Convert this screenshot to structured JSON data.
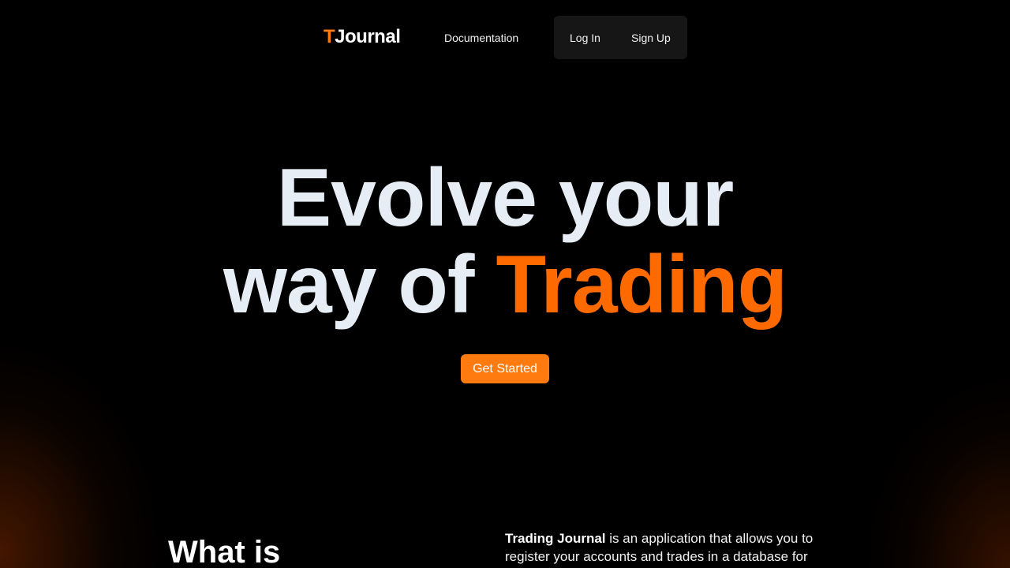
{
  "nav": {
    "logo_accent": "T",
    "logo_rest": "Journal",
    "documentation": "Documentation",
    "login": "Log In",
    "signup": "Sign Up"
  },
  "hero": {
    "line1": "Evolve your",
    "line2_start": "way of",
    "line2_accent": "Trading",
    "cta": "Get Started"
  },
  "about": {
    "heading": "What is",
    "text_bold": "Trading Journal",
    "text_line1_rest": "is an application that allows you to",
    "text_line2": "register your accounts and trades in a database for"
  },
  "colors": {
    "accent": "#ff7a0f",
    "background": "#000000",
    "hero_text": "#e6edf5",
    "nav_box": "#161616"
  }
}
